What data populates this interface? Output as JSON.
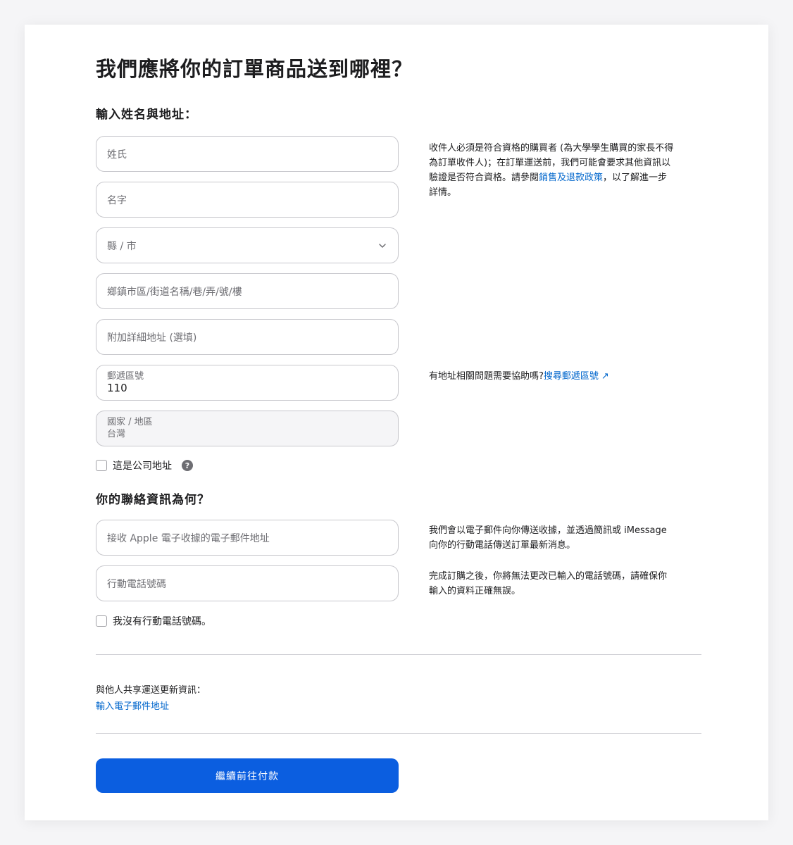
{
  "page_title": "我們應將你的訂單商品送到哪裡？",
  "address_section": {
    "title": "輸入姓名與地址：",
    "last_name_placeholder": "姓氏",
    "first_name_placeholder": "名字",
    "county_city_placeholder": "縣 / 市",
    "street_placeholder": "鄉鎮市區/街道名稱/巷/弄/號/樓",
    "address_extra_placeholder": "附加詳細地址 (選填)",
    "postal_label": "郵遞區號",
    "postal_value": "110",
    "country_label": "國家 / 地區",
    "country_value": "台灣",
    "business_checkbox_label": "這是公司地址",
    "help_glyph": "?"
  },
  "recipient_note": {
    "text_before_link": "收件人必須是符合資格的購買者 (為大學學生購買的家長不得為訂單收件人)；在訂單運送前，我們可能會要求其他資訊以驗證是否符合資格。請參閱",
    "link": "銷售及退款政策",
    "text_after_link": "，以了解進一步詳情。"
  },
  "address_help": {
    "text": "有地址相關問題需要協助嗎?",
    "link": "搜尋郵遞區號",
    "arrow": "↗"
  },
  "contact_section": {
    "title": "你的聯絡資訊為何？",
    "email_placeholder": "接收 Apple 電子收據的電子郵件地址",
    "phone_placeholder": "行動電話號碼",
    "no_phone_label": "我沒有行動電話號碼。"
  },
  "contact_notes": {
    "note1": "我們會以電子郵件向你傳送收據，並透過簡訊或 iMessage 向你的行動電話傳送訂單最新消息。",
    "note2": "完成訂購之後，你將無法更改已輸入的電話號碼，請確保你輸入的資料正確無誤。"
  },
  "share": {
    "label": "與他人共享運送更新資訊：",
    "link": "輸入電子郵件地址"
  },
  "continue_button": "繼續前往付款",
  "colors": {
    "accent": "#0b5ee0",
    "link": "#0066cc",
    "border": "#c7c7cc"
  }
}
